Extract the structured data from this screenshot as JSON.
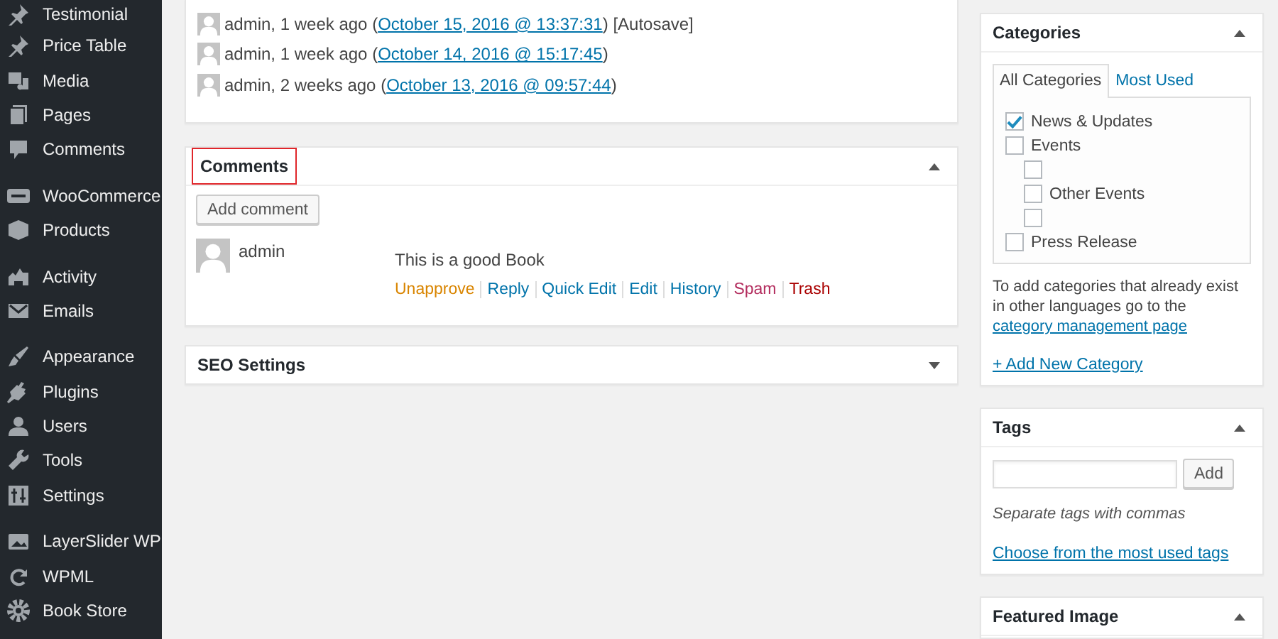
{
  "sidebar": {
    "groups": [
      [
        "Testimonial",
        "Price Table",
        "Media",
        "Pages",
        "Comments"
      ],
      [
        "WooCommerce",
        "Products"
      ],
      [
        "Activity",
        "Emails"
      ],
      [
        "Appearance",
        "Plugins",
        "Users",
        "Tools",
        "Settings"
      ],
      [
        "LayerSlider WP",
        "WPML",
        "Book Store"
      ]
    ]
  },
  "revisions": [
    {
      "before": "admin, 1 week ago (",
      "link": "October 15, 2016 @ 13:37:31",
      "after": ") [Autosave]"
    },
    {
      "before": "admin, 1 week ago (",
      "link": "October 14, 2016 @ 15:17:45",
      "after": ")"
    },
    {
      "before": "admin, 2 weeks ago (",
      "link": "October 13, 2016 @ 09:57:44",
      "after": ")"
    }
  ],
  "comments_box": {
    "title": "Comments",
    "highlighted": true,
    "expanded": true,
    "add_button": "Add comment",
    "comments": [
      {
        "author": "admin",
        "text": "This is a good Book",
        "actions": [
          {
            "label": "Unapprove",
            "kind": "warning"
          },
          {
            "label": "Reply",
            "kind": "normal"
          },
          {
            "label": "Quick Edit",
            "kind": "normal"
          },
          {
            "label": "Edit",
            "kind": "normal"
          },
          {
            "label": "History",
            "kind": "normal"
          },
          {
            "label": "Spam",
            "kind": "spam"
          },
          {
            "label": "Trash",
            "kind": "danger"
          }
        ]
      }
    ]
  },
  "seo_box": {
    "title": "SEO Settings",
    "expanded": false
  },
  "categories_box": {
    "title": "Categories",
    "expanded": true,
    "tabs": [
      {
        "label": "All Categories",
        "selected": true
      },
      {
        "label": "Most Used",
        "selected": false
      }
    ],
    "items": [
      {
        "label": "News & Updates",
        "checked": true
      },
      {
        "label": "Events",
        "checked": false,
        "children": [
          {
            "checked": false
          },
          {
            "label": "Other Events",
            "checked": false
          },
          {
            "checked": false
          }
        ]
      },
      {
        "label": "Press Release",
        "checked": false
      }
    ],
    "note": "To add categories that already exist in other languages go to the ",
    "note_link": "category management page",
    "add_link": "+ Add New Category"
  },
  "tags_box": {
    "title": "Tags",
    "expanded": true,
    "add_button": "Add",
    "hint": "Separate tags with commas",
    "link": "Choose from the most used tags"
  },
  "featured_box": {
    "title": "Featured Image",
    "expanded": true
  }
}
